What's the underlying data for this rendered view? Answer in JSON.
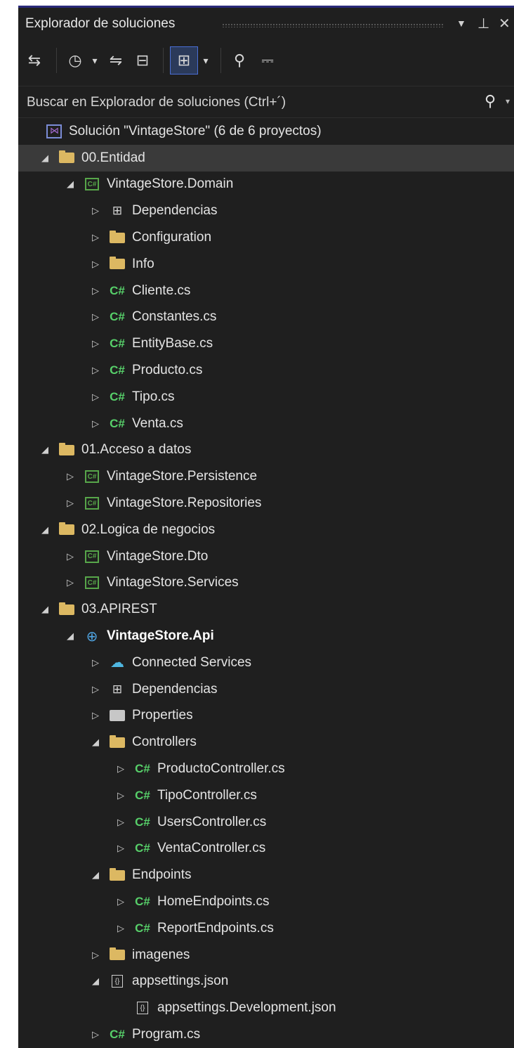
{
  "panel": {
    "title": "Explorador de soluciones",
    "pin_icon": "pin-icon",
    "close_icon": "close-icon",
    "dropdown_icon": "chevron-down-icon"
  },
  "toolbar": {
    "buttons": [
      {
        "name": "sync-with-active-document-icon",
        "glyph": "⇆"
      },
      {
        "name": "pending-changes-icon",
        "glyph": "◷"
      },
      {
        "name": "dropdown-icon",
        "glyph": "▾"
      },
      {
        "name": "switch-views-icon",
        "glyph": "⇋"
      },
      {
        "name": "collapse-all-icon",
        "glyph": "⊟"
      },
      {
        "name": "show-all-files-icon",
        "glyph": "⊞"
      },
      {
        "name": "dropdown-icon",
        "glyph": "▾"
      },
      {
        "name": "properties-wrench-icon",
        "glyph": "🔧"
      },
      {
        "name": "preview-selected-items-icon",
        "glyph": "⎓"
      }
    ]
  },
  "search": {
    "placeholder": "Buscar en Explorador de soluciones (Ctrl+´)"
  },
  "tree": [
    {
      "label": "Solución \"VintageStore\"  (6 de 6 proyectos)",
      "level": 0,
      "exp": "",
      "icon": "sln"
    },
    {
      "label": "00.Entidad",
      "level": 1,
      "exp": "open",
      "icon": "folder",
      "selected": true
    },
    {
      "label": "VintageStore.Domain",
      "level": 2,
      "exp": "open",
      "icon": "csproj"
    },
    {
      "label": "Dependencias",
      "level": 3,
      "exp": "closed",
      "icon": "deps"
    },
    {
      "label": "Configuration",
      "level": 3,
      "exp": "closed",
      "icon": "folder"
    },
    {
      "label": "Info",
      "level": 3,
      "exp": "closed",
      "icon": "folder"
    },
    {
      "label": "Cliente.cs",
      "level": 3,
      "exp": "closed",
      "icon": "cs"
    },
    {
      "label": "Constantes.cs",
      "level": 3,
      "exp": "closed",
      "icon": "cs"
    },
    {
      "label": "EntityBase.cs",
      "level": 3,
      "exp": "closed",
      "icon": "cs"
    },
    {
      "label": "Producto.cs",
      "level": 3,
      "exp": "closed",
      "icon": "cs"
    },
    {
      "label": "Tipo.cs",
      "level": 3,
      "exp": "closed",
      "icon": "cs"
    },
    {
      "label": "Venta.cs",
      "level": 3,
      "exp": "closed",
      "icon": "cs"
    },
    {
      "label": "01.Acceso a datos",
      "level": 1,
      "exp": "open",
      "icon": "folder"
    },
    {
      "label": "VintageStore.Persistence",
      "level": 2,
      "exp": "closed",
      "icon": "csproj"
    },
    {
      "label": "VintageStore.Repositories",
      "level": 2,
      "exp": "closed",
      "icon": "csproj"
    },
    {
      "label": "02.Logica de negocios",
      "level": 1,
      "exp": "open",
      "icon": "folder"
    },
    {
      "label": "VintageStore.Dto",
      "level": 2,
      "exp": "closed",
      "icon": "csproj"
    },
    {
      "label": "VintageStore.Services",
      "level": 2,
      "exp": "closed",
      "icon": "csproj"
    },
    {
      "label": "03.APIREST",
      "level": 1,
      "exp": "open",
      "icon": "folder"
    },
    {
      "label": "VintageStore.Api",
      "level": 2,
      "exp": "open",
      "icon": "web",
      "bold": true
    },
    {
      "label": "Connected Services",
      "level": 3,
      "exp": "closed",
      "icon": "cloud"
    },
    {
      "label": "Dependencias",
      "level": 3,
      "exp": "closed",
      "icon": "deps"
    },
    {
      "label": "Properties",
      "level": 3,
      "exp": "closed",
      "icon": "props"
    },
    {
      "label": "Controllers",
      "level": 3,
      "exp": "open",
      "icon": "folder"
    },
    {
      "label": "ProductoController.cs",
      "level": 4,
      "exp": "closed",
      "icon": "cs"
    },
    {
      "label": "TipoController.cs",
      "level": 4,
      "exp": "closed",
      "icon": "cs"
    },
    {
      "label": "UsersController.cs",
      "level": 4,
      "exp": "closed",
      "icon": "cs"
    },
    {
      "label": "VentaController.cs",
      "level": 4,
      "exp": "closed",
      "icon": "cs"
    },
    {
      "label": "Endpoints",
      "level": 3,
      "exp": "open",
      "icon": "folder"
    },
    {
      "label": "HomeEndpoints.cs",
      "level": 4,
      "exp": "closed",
      "icon": "cs"
    },
    {
      "label": "ReportEndpoints.cs",
      "level": 4,
      "exp": "closed",
      "icon": "cs"
    },
    {
      "label": "imagenes",
      "level": 3,
      "exp": "closed",
      "icon": "folder"
    },
    {
      "label": "appsettings.json",
      "level": 3,
      "exp": "open",
      "icon": "json"
    },
    {
      "label": "appsettings.Development.json",
      "level": 4,
      "exp": "",
      "icon": "json"
    },
    {
      "label": "Program.cs",
      "level": 3,
      "exp": "closed",
      "icon": "cs"
    }
  ]
}
